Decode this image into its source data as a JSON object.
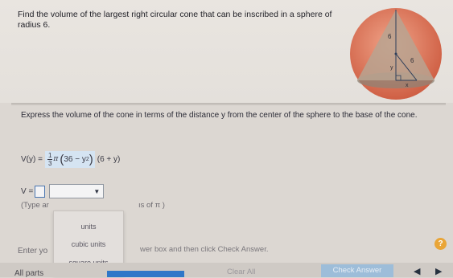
{
  "problem": {
    "text": "Find the volume of the largest right circular cone that can be inscribed in a sphere of radius 6."
  },
  "figure": {
    "label_top": "6",
    "label_slant": "6",
    "label_y": "y",
    "label_x": "x",
    "colors": {
      "sphere": "#e07a5f",
      "cone": "#b9a391"
    }
  },
  "instruction": {
    "text": "Express the volume of the cone in terms of the distance y from the center of the sphere to the base of the cone."
  },
  "formula": {
    "lhs": "V(y) =",
    "frac_num": "1",
    "frac_den": "3",
    "pi": "π",
    "inner": "36 − y",
    "exp": "2",
    "factor": "(6 + y)"
  },
  "answer": {
    "prefix": "V =",
    "selected_unit": ""
  },
  "hints": {
    "type_left": "(Type ar",
    "type_right": "ıs of π )",
    "enter_left": "Enter yo",
    "enter_right": "wer box and then click Check Answer."
  },
  "dropdown": {
    "options": [
      "units",
      "cubic units",
      "square units"
    ]
  },
  "footer": {
    "all_parts": "All parts",
    "clear_all": "Clear All",
    "check_answer": "Check Answer",
    "help": "?",
    "prev": "◀",
    "next": "▶"
  }
}
